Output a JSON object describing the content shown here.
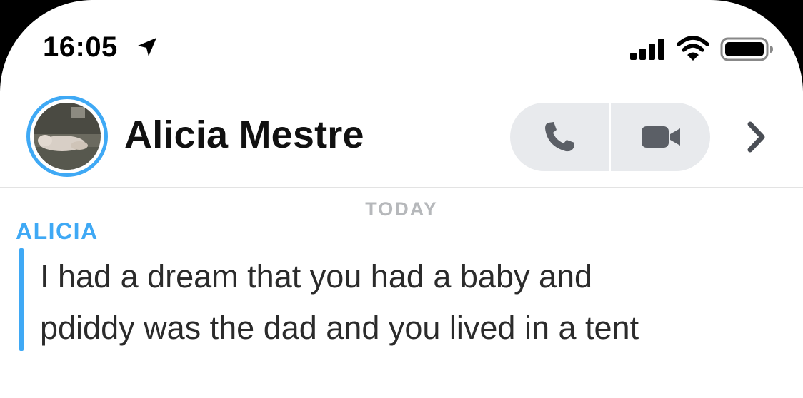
{
  "status_bar": {
    "time": "16:05",
    "icons": [
      "location-arrow-icon",
      "cellular-signal-icon",
      "wifi-icon",
      "battery-icon"
    ]
  },
  "header": {
    "contact_name": "Alicia Mestre",
    "avatar_icon": "contact-avatar",
    "actions": [
      "phone-icon",
      "video-camera-icon",
      "chevron-right-icon"
    ]
  },
  "conversation": {
    "date_label": "TODAY",
    "messages": [
      {
        "sender": "ALICIA",
        "lines": [
          "I had a dream that you had a baby and",
          "pdiddy was the dad and you lived in a tent"
        ]
      }
    ]
  },
  "colors": {
    "accent": "#3fa9f5",
    "call_pill": "#e8eaed",
    "icon_gray": "#5b5f66",
    "date_gray": "#b6b8bb",
    "message_text": "#2b2b2b"
  }
}
